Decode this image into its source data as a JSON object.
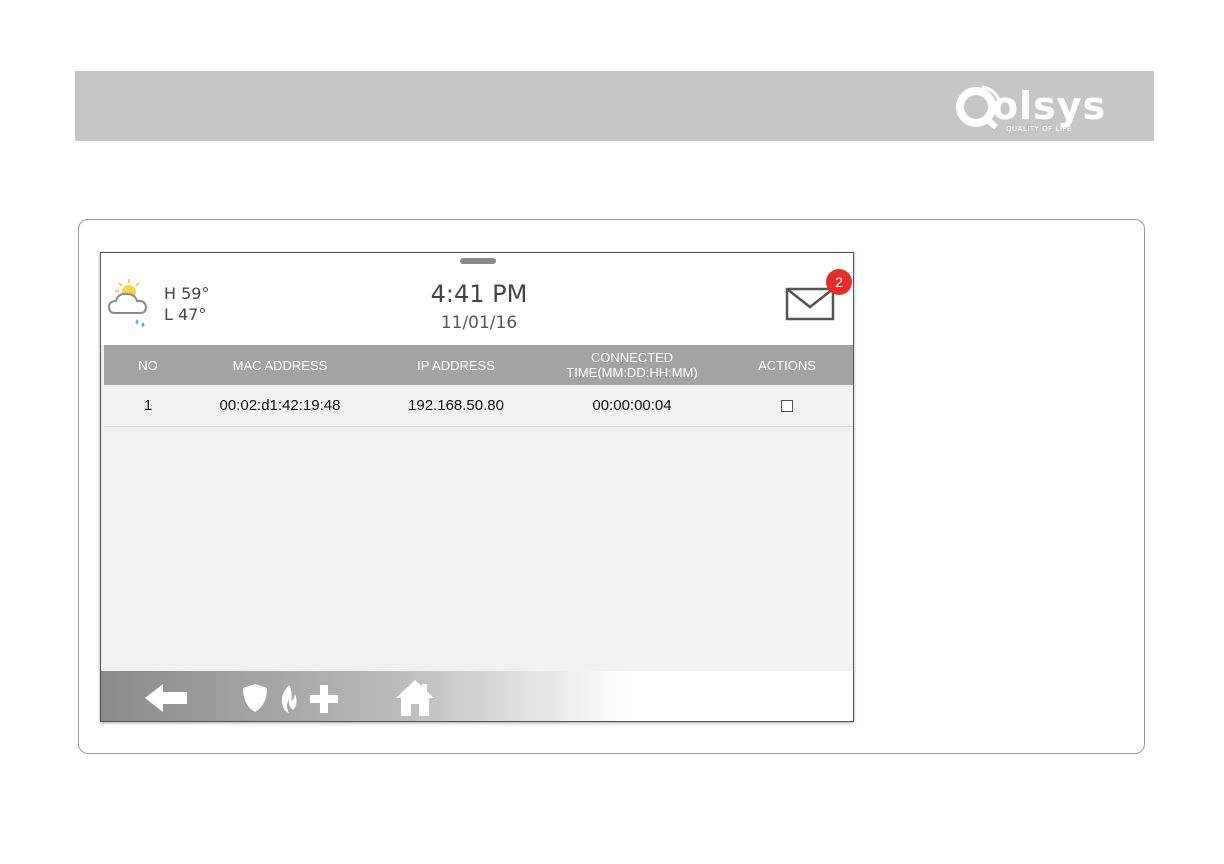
{
  "brand": {
    "name": "olsys",
    "tagline": "QUALITY OF LIFE"
  },
  "status_bar": {
    "weather_icon": "cloud-sun-rain-icon",
    "high_temp": "H 59°",
    "low_temp": "L 47°",
    "time": "4:41 PM",
    "date": "11/01/16",
    "messages_icon": "envelope-icon",
    "message_count": "2"
  },
  "table": {
    "columns": [
      "NO",
      "MAC ADDRESS",
      "IP ADDRESS",
      "CONNECTED\nTIME(MM:DD:HH:MM)",
      "ACTIONS"
    ],
    "rows": [
      {
        "no": "1",
        "mac": "00:02:d1:42:19:48",
        "ip": "192.168.50.80",
        "time": "00:00:00:04",
        "selected": false
      }
    ]
  },
  "nav_bar": {
    "icons": [
      "back-arrow-icon",
      "shield-icon",
      "fire-icon",
      "medical-cross-icon",
      "home-icon"
    ]
  },
  "colors": {
    "banner": "#c6c6c6",
    "table_header": "#a3a3a3",
    "badge": "#e82c2c"
  }
}
